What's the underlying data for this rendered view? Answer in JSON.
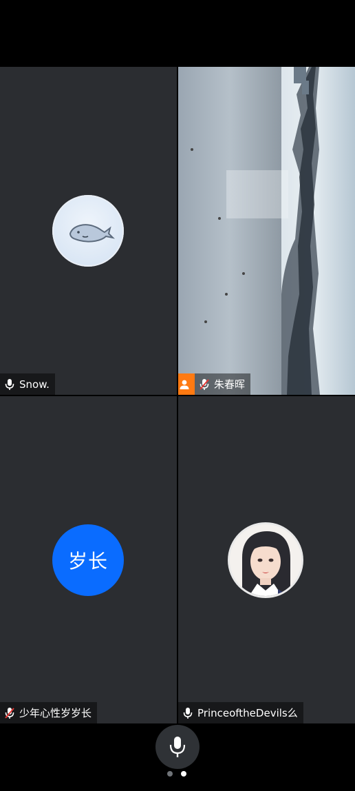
{
  "participants": [
    {
      "name": "Snow.",
      "mic": "on",
      "avatar": "whale-illustration",
      "video": false
    },
    {
      "name": "朱春晖",
      "mic": "muted",
      "host": true,
      "video": true,
      "video_scene": "frozen lake landscape"
    },
    {
      "name": "少年心性岁岁长",
      "mic": "muted",
      "avatar_text": "岁长",
      "avatar_color": "#0a6cff",
      "video": false
    },
    {
      "name": "PrinceoftheDevils么",
      "mic": "on",
      "avatar": "girl-illustration",
      "video": false
    }
  ],
  "controls": {
    "mic_button": "microphone",
    "pager": {
      "pages": 2,
      "current": 2
    }
  },
  "colors": {
    "tile_bg": "#2b2d31",
    "host_badge": "#ff7a12",
    "muted_slash": "#e53935",
    "avatar_blue": "#0a6cff"
  }
}
